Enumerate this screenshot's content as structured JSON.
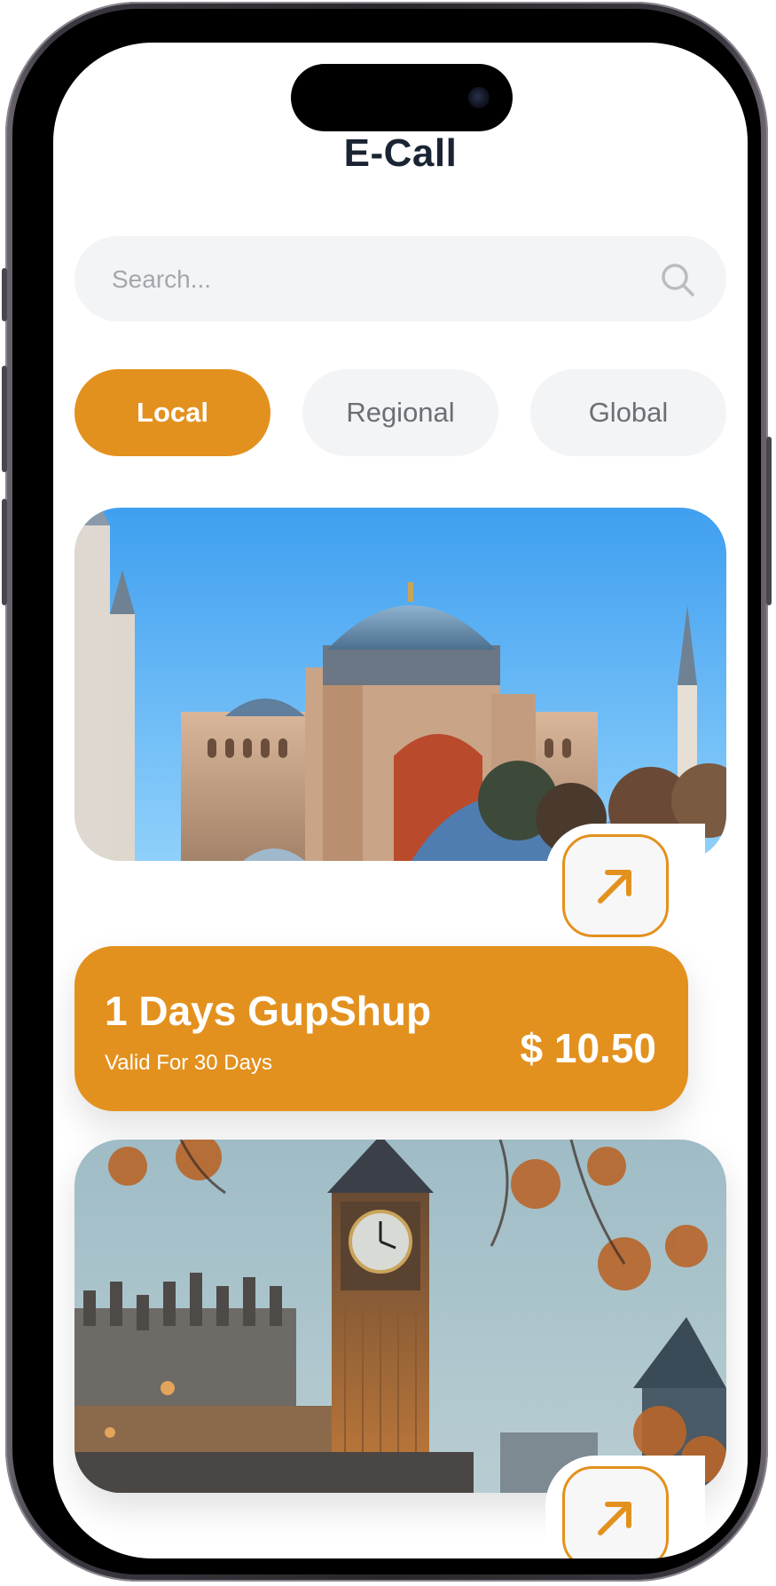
{
  "app": {
    "title": "E-Call"
  },
  "search": {
    "placeholder": "Search...",
    "value": ""
  },
  "tabs": [
    {
      "label": "Local",
      "active": true
    },
    {
      "label": "Regional",
      "active": false
    },
    {
      "label": "Global",
      "active": false
    }
  ],
  "cards": [
    {
      "image_icon": "hagia-sophia-photo",
      "plan_name": "1 Days GupShup",
      "validity": "Valid For 30 Days",
      "price": "$ 10.50",
      "action_icon": "arrow-up-right-icon"
    },
    {
      "image_icon": "big-ben-photo",
      "action_icon": "arrow-up-right-icon"
    }
  ],
  "colors": {
    "accent": "#e3911e",
    "title": "#1a2433",
    "chip_bg": "#f3f4f6",
    "chip_text": "#6b6f75",
    "placeholder": "#a3a7ad"
  }
}
